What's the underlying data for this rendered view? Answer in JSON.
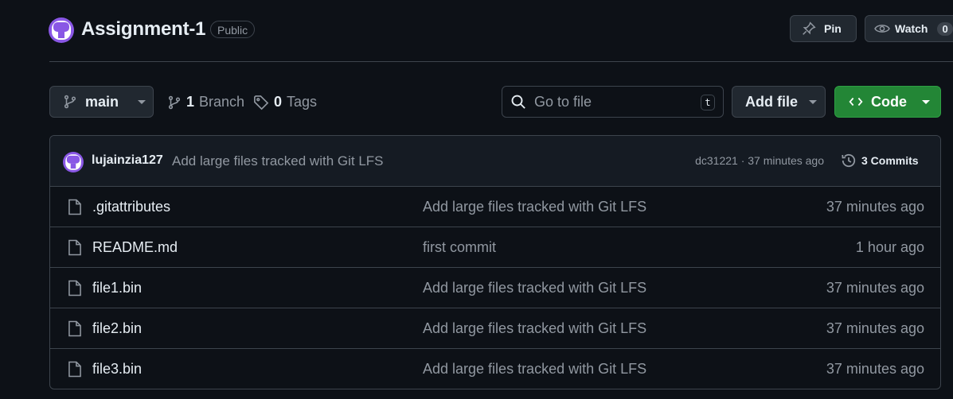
{
  "repo": {
    "name": "Assignment-1",
    "visibility": "Public"
  },
  "header_actions": {
    "pin_label": "Pin",
    "watch_label": "Watch",
    "watch_count": "0"
  },
  "toolbar": {
    "branch": "main",
    "branch_count": "1",
    "branch_label": "Branch",
    "tag_count": "0",
    "tag_label": "Tags",
    "search_placeholder": "Go to file",
    "search_shortcut": "t",
    "add_file_label": "Add file",
    "code_label": "Code"
  },
  "latest_commit": {
    "author": "lujainzia127",
    "message": "Add large files tracked with Git LFS",
    "meta": "dc31221 · 37 minutes ago",
    "commits_label": "3 Commits"
  },
  "files": [
    {
      "name": ".gitattributes",
      "message": "Add large files tracked with Git LFS",
      "time": "37 minutes ago"
    },
    {
      "name": "README.md",
      "message": "first commit",
      "time": "1 hour ago"
    },
    {
      "name": "file1.bin",
      "message": "Add large files tracked with Git LFS",
      "time": "37 minutes ago"
    },
    {
      "name": "file2.bin",
      "message": "Add large files tracked with Git LFS",
      "time": "37 minutes ago"
    },
    {
      "name": "file3.bin",
      "message": "Add large files tracked with Git LFS",
      "time": "37 minutes ago"
    }
  ],
  "colors": {
    "background": "#0d1117",
    "border": "#3d444d",
    "code_button": "#238636",
    "avatar": "#8957e5"
  },
  "icons": [
    "avatar",
    "pin-icon",
    "eye-icon",
    "git-branch-icon",
    "tag-icon",
    "search-icon",
    "code-icon",
    "history-icon",
    "file-icon"
  ]
}
